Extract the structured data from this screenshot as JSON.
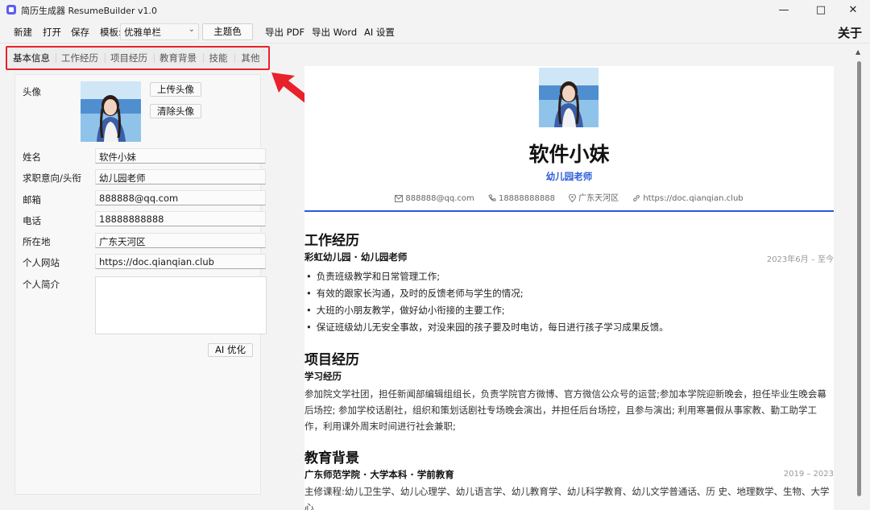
{
  "window": {
    "title": "简历生成器 ResumeBuilder  v1.0"
  },
  "menu": {
    "new": "新建",
    "open": "打开",
    "save": "保存",
    "template_label": "模板:",
    "template_value": "优雅单栏",
    "theme": "主题色",
    "export_pdf": "导出 PDF",
    "export_word": "导出 Word",
    "ai_settings": "AI 设置",
    "about": "关于"
  },
  "tabs": [
    "基本信息",
    "工作经历",
    "项目经历",
    "教育背景",
    "技能",
    "其他"
  ],
  "form": {
    "avatar_label": "头像",
    "upload_avatar": "上传头像",
    "clear_avatar": "清除头像",
    "fields": [
      {
        "label": "姓名",
        "value": "软件小妹"
      },
      {
        "label": "求职意向/头衔",
        "value": "幼儿园老师"
      },
      {
        "label": "邮箱",
        "value": "888888@qq.com"
      },
      {
        "label": "电话",
        "value": "18888888888"
      },
      {
        "label": "所在地",
        "value": "广东天河区"
      },
      {
        "label": "个人网站",
        "value": "https://doc.qianqian.club"
      }
    ],
    "bio_label": "个人简介",
    "bio_value": "",
    "ai_optimize": "AI 优化"
  },
  "resume": {
    "name": "软件小妹",
    "job": "幼儿园老师",
    "contacts": {
      "email": "888888@qq.com",
      "phone": "18888888888",
      "location": "广东天河区",
      "site": "https://doc.qianqian.club"
    },
    "work": {
      "title": "工作经历",
      "sub": "彩虹幼儿园 · 幼儿园老师",
      "date": "2023年6月 – 至今",
      "items": [
        "负责班级教学和日常管理工作;",
        "有效的跟家长沟通，及时的反馈老师与学生的情况;",
        "大班的小朋友教学，做好幼小衔接的主要工作;",
        "保证班级幼儿无安全事故，对没来园的孩子要及时电访，每日进行孩子学习成果反馈。"
      ]
    },
    "project": {
      "title": "项目经历",
      "sub": "学习经历",
      "desc": "参加院文学社团，担任新闻部编辑组组长，负责学院官方微博、官方微信公众号的运营;参加本学院迎新晚会，担任毕业生晚会幕后场控; 参加学校话剧社，组织和策划话剧社专场晚会演出，并担任后台场控，且参与演出; 利用寒暑假从事家教、勤工助学工作，利用课外周末时间进行社会兼职;"
    },
    "education": {
      "title": "教育背景",
      "sub": "广东师范学院 · 大学本科 · 学前教育",
      "date": "2019 – 2023",
      "desc": "主修课程:幼儿卫生学、幼儿心理学、幼儿语言学、幼儿教育学、幼儿科学教育、幼儿文学普通话、历 史、地理数学、生物、大学心"
    }
  },
  "colors": {
    "accent": "#2a5bd7",
    "annotation": "#e8212a"
  }
}
